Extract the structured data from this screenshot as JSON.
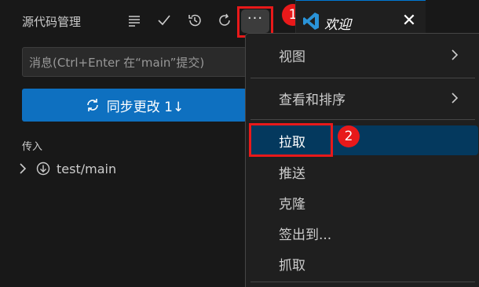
{
  "scm": {
    "title": "源代码管理",
    "commit_placeholder": "消息(Ctrl+Enter 在“main”提交)",
    "sync_button_label": "同步更改 1↓",
    "incoming_section": "传入",
    "tree_item_label": "test/main"
  },
  "tab": {
    "label": "欢迎",
    "close_glyph": "✕"
  },
  "menu": {
    "more_glyph": "···",
    "items": [
      {
        "label": "视图",
        "has_submenu": true
      },
      {
        "label": "查看和排序",
        "has_submenu": true
      },
      {
        "label": "拉取",
        "active": true
      },
      {
        "label": "推送"
      },
      {
        "label": "克隆"
      },
      {
        "label": "签出到..."
      },
      {
        "label": "抓取"
      }
    ]
  },
  "annotations": {
    "badge_1": "1",
    "badge_2": "2"
  },
  "colors": {
    "accent": "#0e70c0",
    "annotation": "#e8191a",
    "menu_active": "#04395e"
  }
}
